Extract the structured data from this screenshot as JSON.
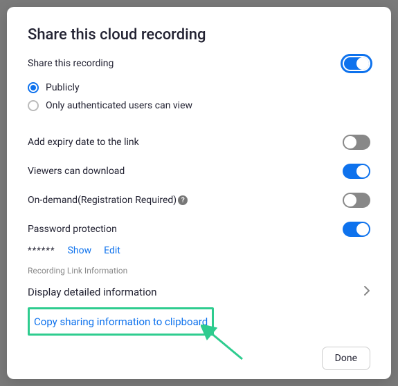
{
  "title": "Share this cloud recording",
  "shareThis": {
    "label": "Share this recording",
    "enabled": true,
    "options": {
      "publicly": "Publicly",
      "authOnly": "Only authenticated users can view",
      "selected": "publicly"
    }
  },
  "settings": {
    "expiry": {
      "label": "Add expiry date to the link",
      "enabled": false
    },
    "download": {
      "label": "Viewers can download",
      "enabled": true
    },
    "ondemand": {
      "label": "On-demand(Registration Required)",
      "enabled": false
    },
    "password": {
      "label": "Password protection",
      "enabled": true
    }
  },
  "password": {
    "mask": "******",
    "showLabel": "Show",
    "editLabel": "Edit"
  },
  "linkInfo": {
    "sectionLabel": "Recording Link Information",
    "displayLabel": "Display detailed information",
    "copyLabel": "Copy sharing information to clipboard"
  },
  "footer": {
    "doneLabel": "Done"
  }
}
